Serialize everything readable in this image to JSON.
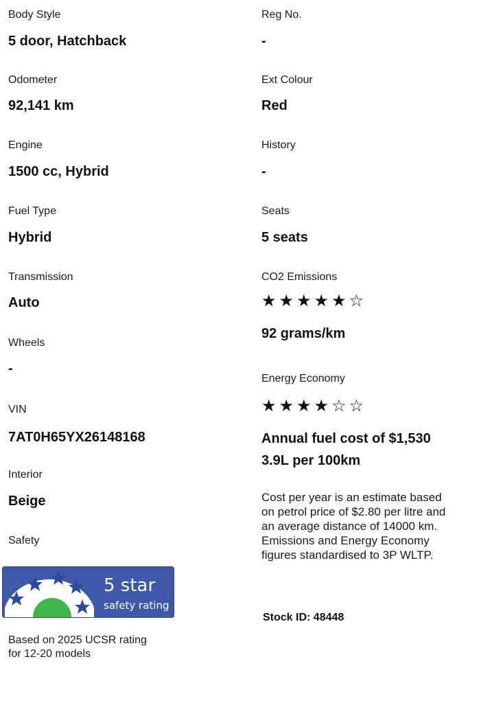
{
  "left": {
    "body_style": {
      "label": "Body Style",
      "value": "5 door, Hatchback"
    },
    "odometer": {
      "label": "Odometer",
      "value": "92,141 km"
    },
    "engine": {
      "label": "Engine",
      "value": "1500 cc, Hybrid"
    },
    "fuel_type": {
      "label": "Fuel Type",
      "value": "Hybrid"
    },
    "transmission": {
      "label": "Transmission",
      "value": "Auto"
    },
    "wheels": {
      "label": "Wheels",
      "value": "-"
    },
    "vin": {
      "label": "VIN",
      "value": "7AT0H65YX26148168"
    },
    "interior": {
      "label": "Interior",
      "value": "Beige"
    },
    "safety": {
      "label": "Safety",
      "badge": {
        "stars_text": "5 star",
        "rating_text": "safety rating",
        "rating": 5
      },
      "note_line1": "Based on 2025 UCSR rating",
      "note_line2": "for 12-20 models"
    }
  },
  "right": {
    "reg_no": {
      "label": "Reg No.",
      "value": "-"
    },
    "ext_colour": {
      "label": "Ext Colour",
      "value": "Red"
    },
    "history": {
      "label": "History",
      "value": "-"
    },
    "seats": {
      "label": "Seats",
      "value": "5 seats"
    },
    "co2": {
      "label": "CO2 Emissions",
      "rating": 5,
      "max_rating": 6,
      "stars_filled": "★★★★★",
      "stars_empty": "☆",
      "value": "92 grams/km"
    },
    "energy": {
      "label": "Energy Economy",
      "rating": 4,
      "max_rating": 6,
      "stars_filled": "★★★★",
      "stars_empty": "☆☆",
      "fuel_cost": "Annual fuel cost of $1,530",
      "consumption": "3.9L per 100km"
    },
    "note_lines": [
      "Cost per year is an estimate based",
      "on petrol price of  $2.80 per litre and",
      "an average distance of 14000 km.",
      "Emissions and Energy Economy",
      "figures standardised to 3P WLTP."
    ],
    "stock_id": "Stock ID: 48448"
  },
  "colors": {
    "badge_blue": "#3d59a8",
    "badge_white": "#ffffff",
    "badge_green": "#3fb649",
    "star_blue": "#2b4a9e"
  }
}
